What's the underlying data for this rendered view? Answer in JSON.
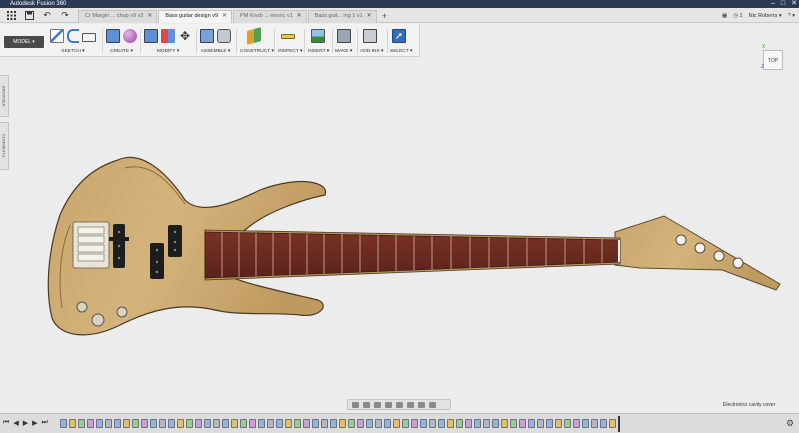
{
  "titlebar": {
    "title": "Autodesk Fusion 360",
    "minimize": "–",
    "maximize": "□",
    "close": "✕"
  },
  "qat": {
    "grid_icon": "grid-icon",
    "save_icon": "save-icon",
    "undo_icon": "undo-icon",
    "redo_icon": "redo-icon",
    "tabs": [
      {
        "label": "Cr Margin ... chup v9 v2",
        "active": false
      },
      {
        "label": "Bass guitar design v9",
        "active": true
      },
      {
        "label": "PM Knob ... enoric v1",
        "active": false
      },
      {
        "label": "Bass guit... ing 1 v1",
        "active": false
      }
    ],
    "add_tab": "+",
    "jobs_count": "1",
    "user": "Nic Roberts",
    "help": "?"
  },
  "ribbon": {
    "workspace": "MODEL",
    "groups": [
      {
        "label": "SKETCH ▾"
      },
      {
        "label": "CREATE ▾"
      },
      {
        "label": "MODIFY ▾"
      },
      {
        "label": "ASSEMBLE ▾"
      },
      {
        "label": "CONSTRUCT ▾"
      },
      {
        "label": "INSPECT ▾"
      },
      {
        "label": "INSERT ▾"
      },
      {
        "label": "MAKE ▾"
      },
      {
        "label": "ADD-INS ▾"
      },
      {
        "label": "SELECT ▾"
      }
    ]
  },
  "side_panels": {
    "browser": "BROWSER",
    "comments": "COMMENTS"
  },
  "viewcube": {
    "face": "TOP",
    "x_axis": "X",
    "z_axis": "Z"
  },
  "status": {
    "selection": "Electronics cavity cover"
  },
  "colors": {
    "accent": "#2b6cb0",
    "body_wood": "#c9a46a",
    "fretboard": "#6b2a22",
    "titlebar": "#2b3a55"
  }
}
